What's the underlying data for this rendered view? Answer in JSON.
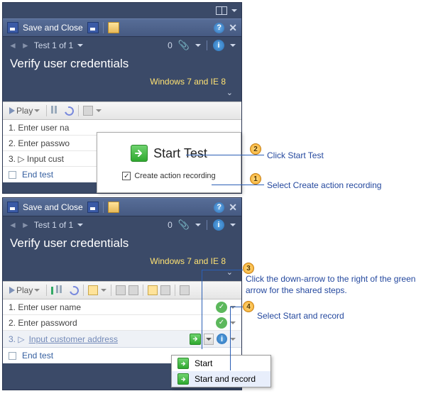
{
  "toolbar": {
    "save_and_close": "Save and Close"
  },
  "tabs": {
    "label": "Test 1 of 1",
    "count": "0"
  },
  "title": "Verify user credentials",
  "subtitle": "Windows 7 and IE 8",
  "playbar": {
    "play": "Play"
  },
  "pane1_steps": {
    "s1": "1. Enter user na",
    "s2": "2. Enter passwo",
    "s3": "3. ▷  Input cust",
    "s4": "End test"
  },
  "start_popup": {
    "start": "Start Test",
    "checkbox_label": "Create action recording"
  },
  "pane2_steps": {
    "s1": "1. Enter user name",
    "s2": "2. Enter password",
    "s3_num": "3. ▷",
    "s3_text": "Input customer address",
    "s4": "End test"
  },
  "menu": {
    "item1": "Start",
    "item2": "Start and record"
  },
  "callouts": {
    "c1": "Select Create action recording",
    "c2": "Click Start Test",
    "c3": "Click the down-arrow to the right of the green arrow for the shared steps.",
    "c4": "Select Start and record",
    "n1": "1",
    "n2": "2",
    "n3": "3",
    "n4": "4"
  }
}
